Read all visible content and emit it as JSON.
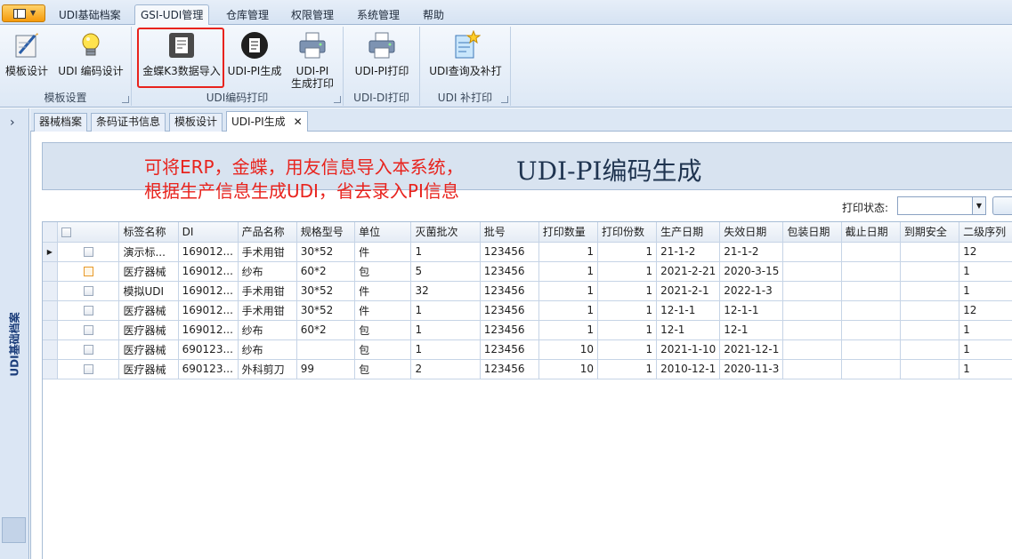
{
  "menu": {
    "tabs": [
      {
        "label": "UDI基础档案"
      },
      {
        "label": "GSI-UDI管理"
      },
      {
        "label": "仓库管理"
      },
      {
        "label": "权限管理"
      },
      {
        "label": "系统管理"
      },
      {
        "label": "帮助"
      }
    ]
  },
  "ribbon": {
    "groups": [
      {
        "label": "模板设置",
        "buttons": [
          {
            "label": "模板设计"
          },
          {
            "label": "UDI 编码设计"
          }
        ]
      },
      {
        "label": "UDI编码打印",
        "buttons": [
          {
            "label": "金蝶K3数据导入"
          },
          {
            "label": "UDI-PI生成"
          },
          {
            "label": "UDI-PI",
            "label2": "生成打印"
          }
        ]
      },
      {
        "label": "UDI-DI打印",
        "buttons": [
          {
            "label": "UDI-PI打印"
          }
        ]
      },
      {
        "label": "UDI 补打印",
        "buttons": [
          {
            "label": "UDI查询及补打"
          }
        ]
      }
    ]
  },
  "left_panel": {
    "label": "UDI基础档案"
  },
  "doc_tabs": [
    {
      "label": "器械档案"
    },
    {
      "label": "条码证书信息"
    },
    {
      "label": "模板设计"
    },
    {
      "label": "UDI-PI生成",
      "close": "✕"
    }
  ],
  "banner": {
    "title": "UDI-PI编码生成",
    "annotation_line1": "可将ERP，金蝶，用友信息导入本系统，",
    "annotation_line2": "根据生产信息生成UDI，省去录入PI信息"
  },
  "filter": {
    "print_status_label": "打印状态:",
    "print_status_value": ""
  },
  "grid": {
    "columns": [
      "",
      "标签名称",
      "DI",
      "产品名称",
      "规格型号",
      "单位",
      "灭菌批次",
      "批号",
      "打印数量",
      "打印份数",
      "生产日期",
      "失效日期",
      "包装日期",
      "截止日期",
      "到期安全",
      "二级序列"
    ],
    "rows": [
      {
        "current": true,
        "checked_style": "normal",
        "cells": [
          "演示标...",
          "169012...",
          "手术用钳",
          "30*52",
          "件",
          "1",
          "123456",
          "1",
          "1",
          "21-1-2",
          "21-1-2",
          "",
          "",
          "",
          "12"
        ]
      },
      {
        "current": false,
        "checked_style": "orange",
        "cells": [
          "医疗器械",
          "169012...",
          "纱布",
          "60*2",
          "包",
          "5",
          "123456",
          "1",
          "1",
          "2021-2-21",
          "2020-3-15",
          "",
          "",
          "",
          "1"
        ]
      },
      {
        "current": false,
        "checked_style": "normal",
        "cells": [
          "模拟UDI",
          "169012...",
          "手术用钳",
          "30*52",
          "件",
          "32",
          "123456",
          "1",
          "1",
          "2021-2-1",
          "2022-1-3",
          "",
          "",
          "",
          "1"
        ]
      },
      {
        "current": false,
        "checked_style": "normal",
        "cells": [
          "医疗器械",
          "169012...",
          "手术用钳",
          "30*52",
          "件",
          "1",
          "123456",
          "1",
          "1",
          "12-1-1",
          "12-1-1",
          "",
          "",
          "",
          "12"
        ]
      },
      {
        "current": false,
        "checked_style": "normal",
        "cells": [
          "医疗器械",
          "169012...",
          "纱布",
          "60*2",
          "包",
          "1",
          "123456",
          "1",
          "1",
          "12-1",
          "12-1",
          "",
          "",
          "",
          "1"
        ]
      },
      {
        "current": false,
        "checked_style": "normal",
        "cells": [
          "医疗器械",
          "690123...",
          "纱布",
          "",
          "包",
          "1",
          "123456",
          "10",
          "1",
          "2021-1-10",
          "2021-12-1",
          "",
          "",
          "",
          "1"
        ]
      },
      {
        "current": false,
        "checked_style": "normal",
        "cells": [
          "医疗器械",
          "690123...",
          "外科剪刀",
          "99",
          "包",
          "2",
          "123456",
          "10",
          "1",
          "2010-12-1",
          "2020-11-3",
          "",
          "",
          "",
          "1"
        ]
      }
    ]
  },
  "colors": {
    "highlight_border": "#e8231d",
    "annotation_text": "#e8231d",
    "banner_bg": "#d8e3f0"
  }
}
